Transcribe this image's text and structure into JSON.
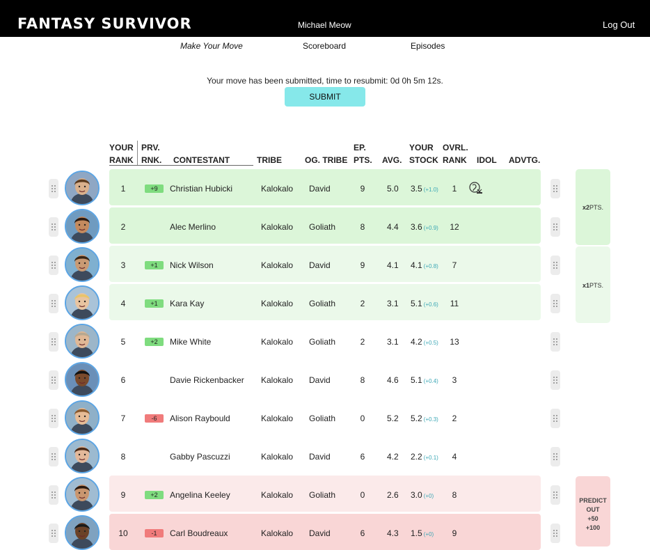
{
  "header": {
    "logo": "FANTASY SURVIVOR",
    "user": "Michael Meow",
    "logout": "Log Out"
  },
  "nav": {
    "make_move": "Make Your Move",
    "scoreboard": "Scoreboard",
    "episodes": "Episodes"
  },
  "status": {
    "message": "Your move has been submitted, time to resubmit: 0d 0h 5m 12s.",
    "submit_label": "SUBMIT"
  },
  "columns": {
    "your_rank_1": "YOUR",
    "your_rank_2": "RANK",
    "prv_rank_1": "PRV.",
    "prv_rank_2": "RNK.",
    "contestant": "CONTESTANT",
    "tribe": "TRIBE",
    "og_tribe": "OG. TRIBE",
    "ep_pts_1": "EP.",
    "ep_pts_2": "PTS.",
    "avg": "AVG.",
    "stock_1": "YOUR",
    "stock_2": "STOCK",
    "ovrl_1": "OVRL.",
    "ovrl_2": "RANK",
    "idol": "IDOL",
    "advtg": "ADVTG."
  },
  "rows": [
    {
      "rank": "1",
      "change": "+9",
      "name": "Christian Hubicki",
      "tribe": "Kalokalo",
      "og_tribe": "David",
      "ep_pts": "9",
      "avg": "5.0",
      "stock": "3.5",
      "stock_delta": "(+1.0)",
      "ovrl": "1",
      "idol": true
    },
    {
      "rank": "2",
      "change": "",
      "name": "Alec Merlino",
      "tribe": "Kalokalo",
      "og_tribe": "Goliath",
      "ep_pts": "8",
      "avg": "4.4",
      "stock": "3.6",
      "stock_delta": "(+0.9)",
      "ovrl": "12",
      "idol": false
    },
    {
      "rank": "3",
      "change": "+1",
      "name": "Nick Wilson",
      "tribe": "Kalokalo",
      "og_tribe": "David",
      "ep_pts": "9",
      "avg": "4.1",
      "stock": "4.1",
      "stock_delta": "(+0.8)",
      "ovrl": "7",
      "idol": false
    },
    {
      "rank": "4",
      "change": "+1",
      "name": "Kara Kay",
      "tribe": "Kalokalo",
      "og_tribe": "Goliath",
      "ep_pts": "2",
      "avg": "3.1",
      "stock": "5.1",
      "stock_delta": "(+0.6)",
      "ovrl": "11",
      "idol": false
    },
    {
      "rank": "5",
      "change": "+2",
      "name": "Mike White",
      "tribe": "Kalokalo",
      "og_tribe": "Goliath",
      "ep_pts": "2",
      "avg": "3.1",
      "stock": "4.2",
      "stock_delta": "(+0.5)",
      "ovrl": "13",
      "idol": false
    },
    {
      "rank": "6",
      "change": "",
      "name": "Davie Rickenbacker",
      "tribe": "Kalokalo",
      "og_tribe": "David",
      "ep_pts": "8",
      "avg": "4.6",
      "stock": "5.1",
      "stock_delta": "(+0.4)",
      "ovrl": "3",
      "idol": false
    },
    {
      "rank": "7",
      "change": "-6",
      "name": "Alison Raybould",
      "tribe": "Kalokalo",
      "og_tribe": "Goliath",
      "ep_pts": "0",
      "avg": "5.2",
      "stock": "5.2",
      "stock_delta": "(+0.3)",
      "ovrl": "2",
      "idol": false
    },
    {
      "rank": "8",
      "change": "",
      "name": "Gabby Pascuzzi",
      "tribe": "Kalokalo",
      "og_tribe": "David",
      "ep_pts": "6",
      "avg": "4.2",
      "stock": "2.2",
      "stock_delta": "(+0.1)",
      "ovrl": "4",
      "idol": false
    },
    {
      "rank": "9",
      "change": "+2",
      "name": "Angelina Keeley",
      "tribe": "Kalokalo",
      "og_tribe": "Goliath",
      "ep_pts": "0",
      "avg": "2.6",
      "stock": "3.0",
      "stock_delta": "(+0)",
      "ovrl": "8",
      "idol": false
    },
    {
      "rank": "10",
      "change": "-1",
      "name": "Carl Boudreaux",
      "tribe": "Kalokalo",
      "og_tribe": "David",
      "ep_pts": "6",
      "avg": "4.3",
      "stock": "1.5",
      "stock_delta": "(+0)",
      "ovrl": "9",
      "idol": false
    }
  ],
  "multipliers": {
    "x2_prefix": "x2",
    "x2_suffix": "PTS.",
    "x1_prefix": "x1",
    "x1_suffix": "PTS.",
    "predict_1": "PREDICT",
    "predict_2": "OUT",
    "predict_3": "+50",
    "predict_4": "+100"
  },
  "colors": {
    "accent": "#86e8ea",
    "top_green": "#dcf6d9",
    "mid_green": "#ebf9ea",
    "bottom_red": "#f9d6d6",
    "badge_up": "#7fdc7f",
    "badge_down": "#f07b7b",
    "avatar_ring": "#5aa5e6"
  }
}
